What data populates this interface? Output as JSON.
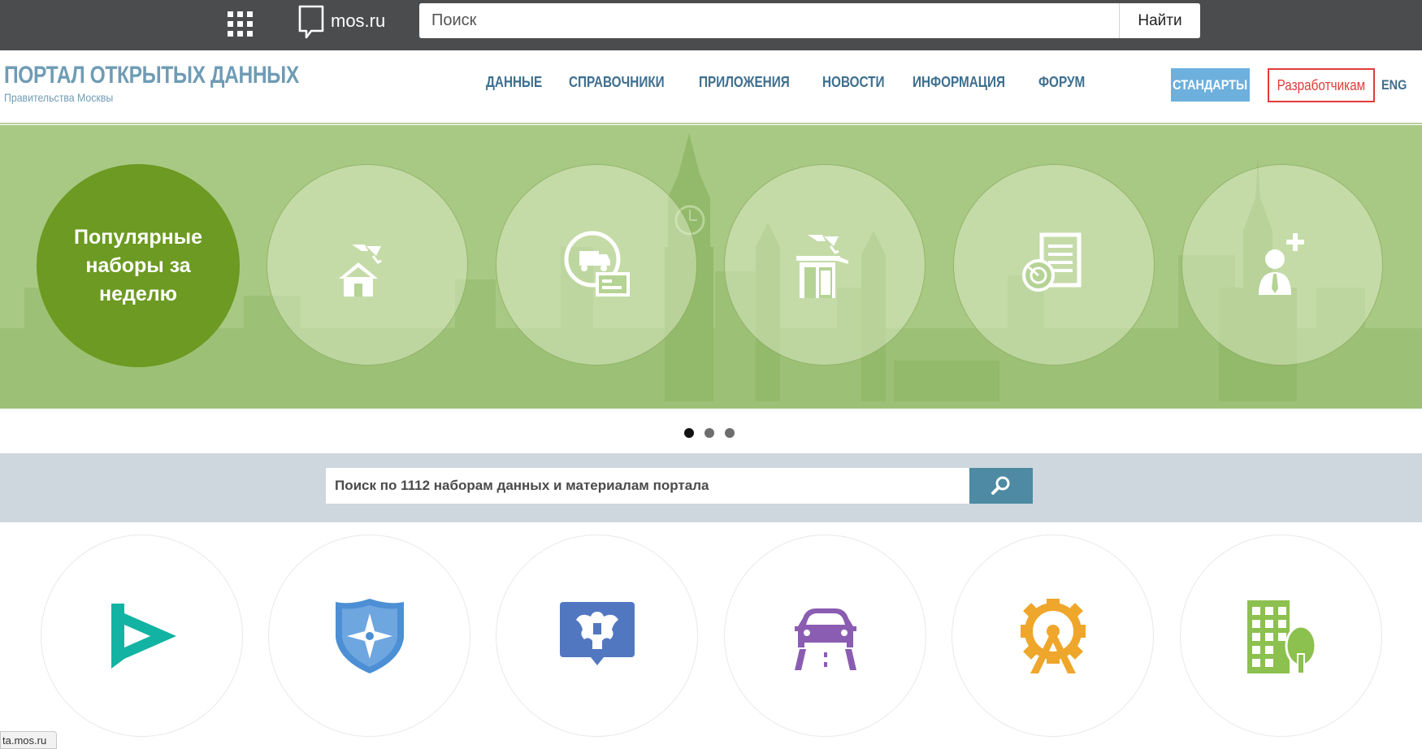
{
  "topbar": {
    "logo_text": "mos.ru",
    "search_placeholder": "Поиск",
    "search_button": "Найти"
  },
  "header": {
    "title": "ПОРТАЛ ОТКРЫТЫХ ДАННЫХ",
    "subtitle": "Правительства Москвы",
    "nav": [
      "ДАННЫЕ",
      "СПРАВОЧНИКИ",
      "ПРИЛОЖЕНИЯ",
      "НОВОСТИ",
      "ИНФОРМАЦИЯ",
      "ФОРУМ"
    ],
    "standards_button": "СТАНДАРТЫ",
    "developers_button": "Разработчикам",
    "lang": "ENG"
  },
  "banner": {
    "popular_label": "Популярные наборы за неделю",
    "items": [
      {
        "icon": "house-camera-icon"
      },
      {
        "icon": "truck-permit-icon"
      },
      {
        "icon": "booth-camera-icon"
      },
      {
        "icon": "document-stamp-icon"
      },
      {
        "icon": "add-person-icon"
      }
    ],
    "slides_total": 3,
    "active_slide": 1
  },
  "search": {
    "placeholder": "Поиск по 1112 наборам данных и материалам портала"
  },
  "categories": [
    {
      "icon": "play-triangle-icon",
      "color": "#12b3a2"
    },
    {
      "icon": "emergency-shield-icon",
      "color": "#4c8fd4"
    },
    {
      "icon": "state-emblem-icon",
      "color": "#5277c1"
    },
    {
      "icon": "car-road-icon",
      "color": "#8a5cb2"
    },
    {
      "icon": "ferris-wheel-icon",
      "color": "#eea62b"
    },
    {
      "icon": "building-tree-icon",
      "color": "#8cc04f"
    }
  ],
  "status_tip": "ta.mos.ru"
}
